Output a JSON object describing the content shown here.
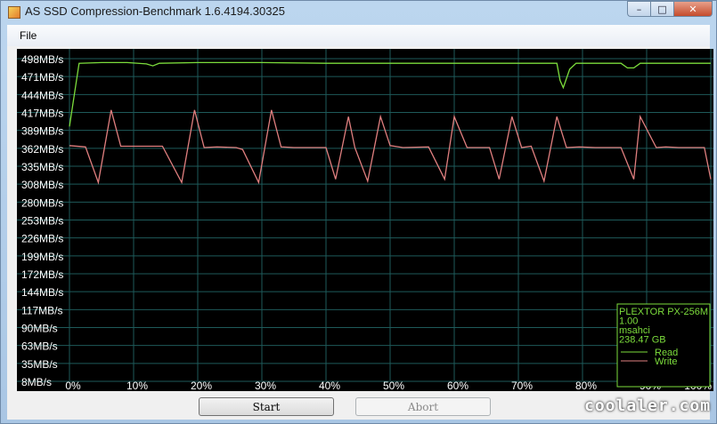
{
  "window": {
    "title": "AS SSD Compression-Benchmark 1.6.4194.30325"
  },
  "menu": {
    "file": "File"
  },
  "controls": {
    "minimize": "–",
    "maximize": "□",
    "close": "✕"
  },
  "buttons": {
    "start": "Start",
    "abort": "Abort"
  },
  "watermark": "coolaler.com",
  "colors": {
    "read": "#7cdc3c",
    "write": "#e07f7f",
    "grid": "#1e5a5a",
    "background": "#000000",
    "text": "#ffffff"
  },
  "legend": {
    "device": "PLEXTOR PX-256M",
    "firmware": "1.00",
    "driver": "msahci",
    "size": "238.47 GB",
    "read_label": "Read",
    "write_label": "Write"
  },
  "chart_data": {
    "type": "line",
    "title": "",
    "y_ticks": [
      "498MB/s",
      "471MB/s",
      "444MB/s",
      "417MB/s",
      "389MB/s",
      "362MB/s",
      "335MB/s",
      "308MB/s",
      "280MB/s",
      "253MB/s",
      "226MB/s",
      "199MB/s",
      "172MB/s",
      "144MB/s",
      "117MB/s",
      "90MB/s",
      "63MB/s",
      "35MB/s",
      "8MB/s"
    ],
    "x_ticks": [
      "0%",
      "10%",
      "20%",
      "30%",
      "40%",
      "50%",
      "60%",
      "70%",
      "80%",
      "90%",
      "100%"
    ],
    "xlim": [
      0,
      100
    ],
    "ylim": [
      8,
      498
    ],
    "grid": true,
    "legend_position": "bottom-right",
    "series": [
      {
        "name": "Read",
        "color": "#7cdc3c",
        "x": [
          0,
          1.5,
          5,
          9,
          12,
          13,
          14,
          20,
          30,
          40,
          50,
          60,
          70,
          76,
          76.5,
          77,
          78,
          79,
          86,
          87,
          88,
          89,
          95,
          100
        ],
        "y": [
          395,
          491,
          492,
          492,
          490,
          487,
          491,
          492,
          492,
          491,
          491,
          491,
          491,
          491,
          465,
          454,
          482,
          491,
          491,
          484,
          484,
          491,
          491,
          491
        ]
      },
      {
        "name": "Write",
        "color": "#e07f7f",
        "x": [
          0,
          2.5,
          4.5,
          6.5,
          8,
          10,
          14.5,
          17.5,
          19.5,
          21,
          23,
          26,
          27,
          29.5,
          31.5,
          33,
          35,
          40,
          41.5,
          43.5,
          44.5,
          46.5,
          48.5,
          50,
          52,
          56,
          58.5,
          60,
          62,
          65.5,
          67,
          69,
          70.5,
          72,
          74,
          76,
          77.5,
          79.5,
          82,
          86,
          88,
          89,
          91.5,
          93,
          95,
          99,
          100
        ],
        "y": [
          366,
          364,
          310,
          420,
          365,
          365,
          365,
          310,
          420,
          363,
          364,
          363,
          360,
          310,
          420,
          364,
          363,
          363,
          315,
          410,
          363,
          312,
          410,
          366,
          363,
          364,
          315,
          410,
          363,
          363,
          315,
          410,
          363,
          365,
          312,
          410,
          363,
          364,
          363,
          363,
          315,
          410,
          363,
          364,
          363,
          363,
          315
        ]
      }
    ]
  }
}
